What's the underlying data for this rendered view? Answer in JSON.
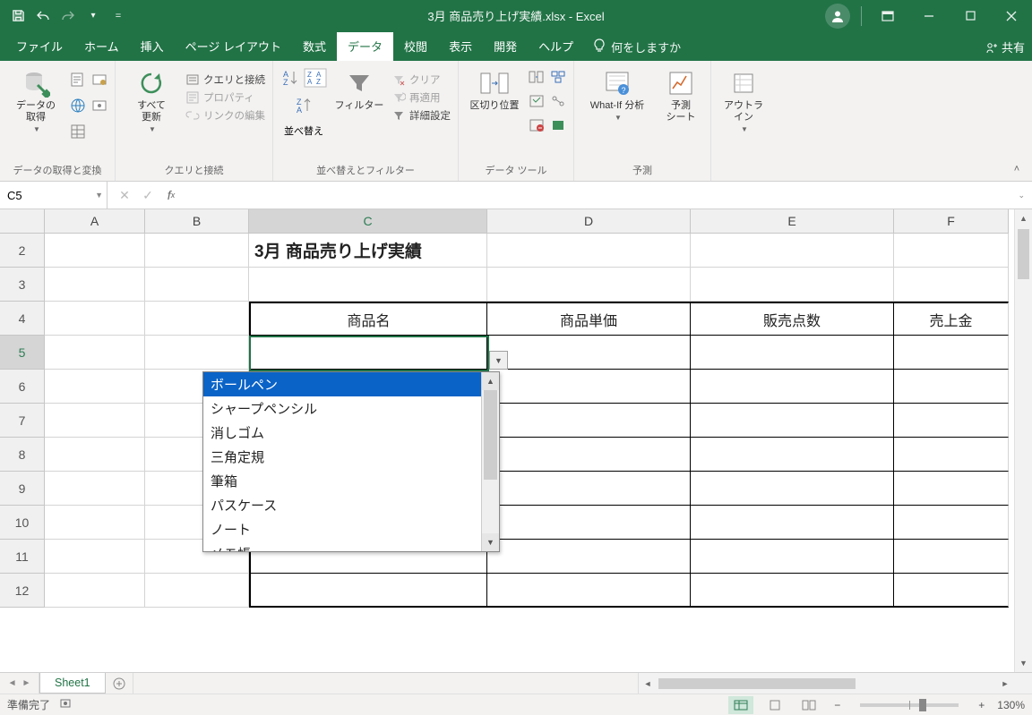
{
  "title": {
    "file": "3月 商品売り上げ実績.xlsx",
    "sep": " - ",
    "app": "Excel"
  },
  "tabs": {
    "file": "ファイル",
    "home": "ホーム",
    "insert": "挿入",
    "layout": "ページ レイアウト",
    "formulas": "数式",
    "data": "データ",
    "review": "校閲",
    "view": "表示",
    "developer": "開発",
    "help": "ヘルプ",
    "tellme": "何をしますか",
    "share": "共有"
  },
  "ribbon": {
    "g1_big": "データの\n取得",
    "g1_label": "データの取得と変換",
    "g2_big": "すべて\n更新",
    "g2_a": "クエリと接続",
    "g2_b": "プロパティ",
    "g2_c": "リンクの編集",
    "g2_label": "クエリと接続",
    "g3_big": "並べ替え",
    "g3_filter": "フィルター",
    "g3_a": "クリア",
    "g3_b": "再適用",
    "g3_c": "詳細設定",
    "g3_label": "並べ替えとフィルター",
    "g4_big": "区切り位置",
    "g4_label": "データ ツール",
    "g5_a": "What-If 分析",
    "g5_b": "予測\nシート",
    "g5_label": "予測",
    "g6_big": "アウトラ\nイン"
  },
  "namebox": "C5",
  "columns": [
    "A",
    "B",
    "C",
    "D",
    "E",
    "F"
  ],
  "rownums": [
    2,
    3,
    4,
    5,
    6,
    7,
    8,
    9,
    10,
    11,
    12
  ],
  "cells": {
    "c2": "3月 商品売り上げ実績",
    "c4": "商品名",
    "d4": "商品単価",
    "e4": "販売点数",
    "f4": "売上金"
  },
  "dropdown": {
    "items": [
      "ボールペン",
      "シャープペンシル",
      "消しゴム",
      "三角定規",
      "筆箱",
      "パスケース",
      "ノート",
      "メモ帳"
    ],
    "selected": 0
  },
  "sheet_tab": "Sheet1",
  "status": {
    "ready": "準備完了",
    "zoom": "130%"
  }
}
